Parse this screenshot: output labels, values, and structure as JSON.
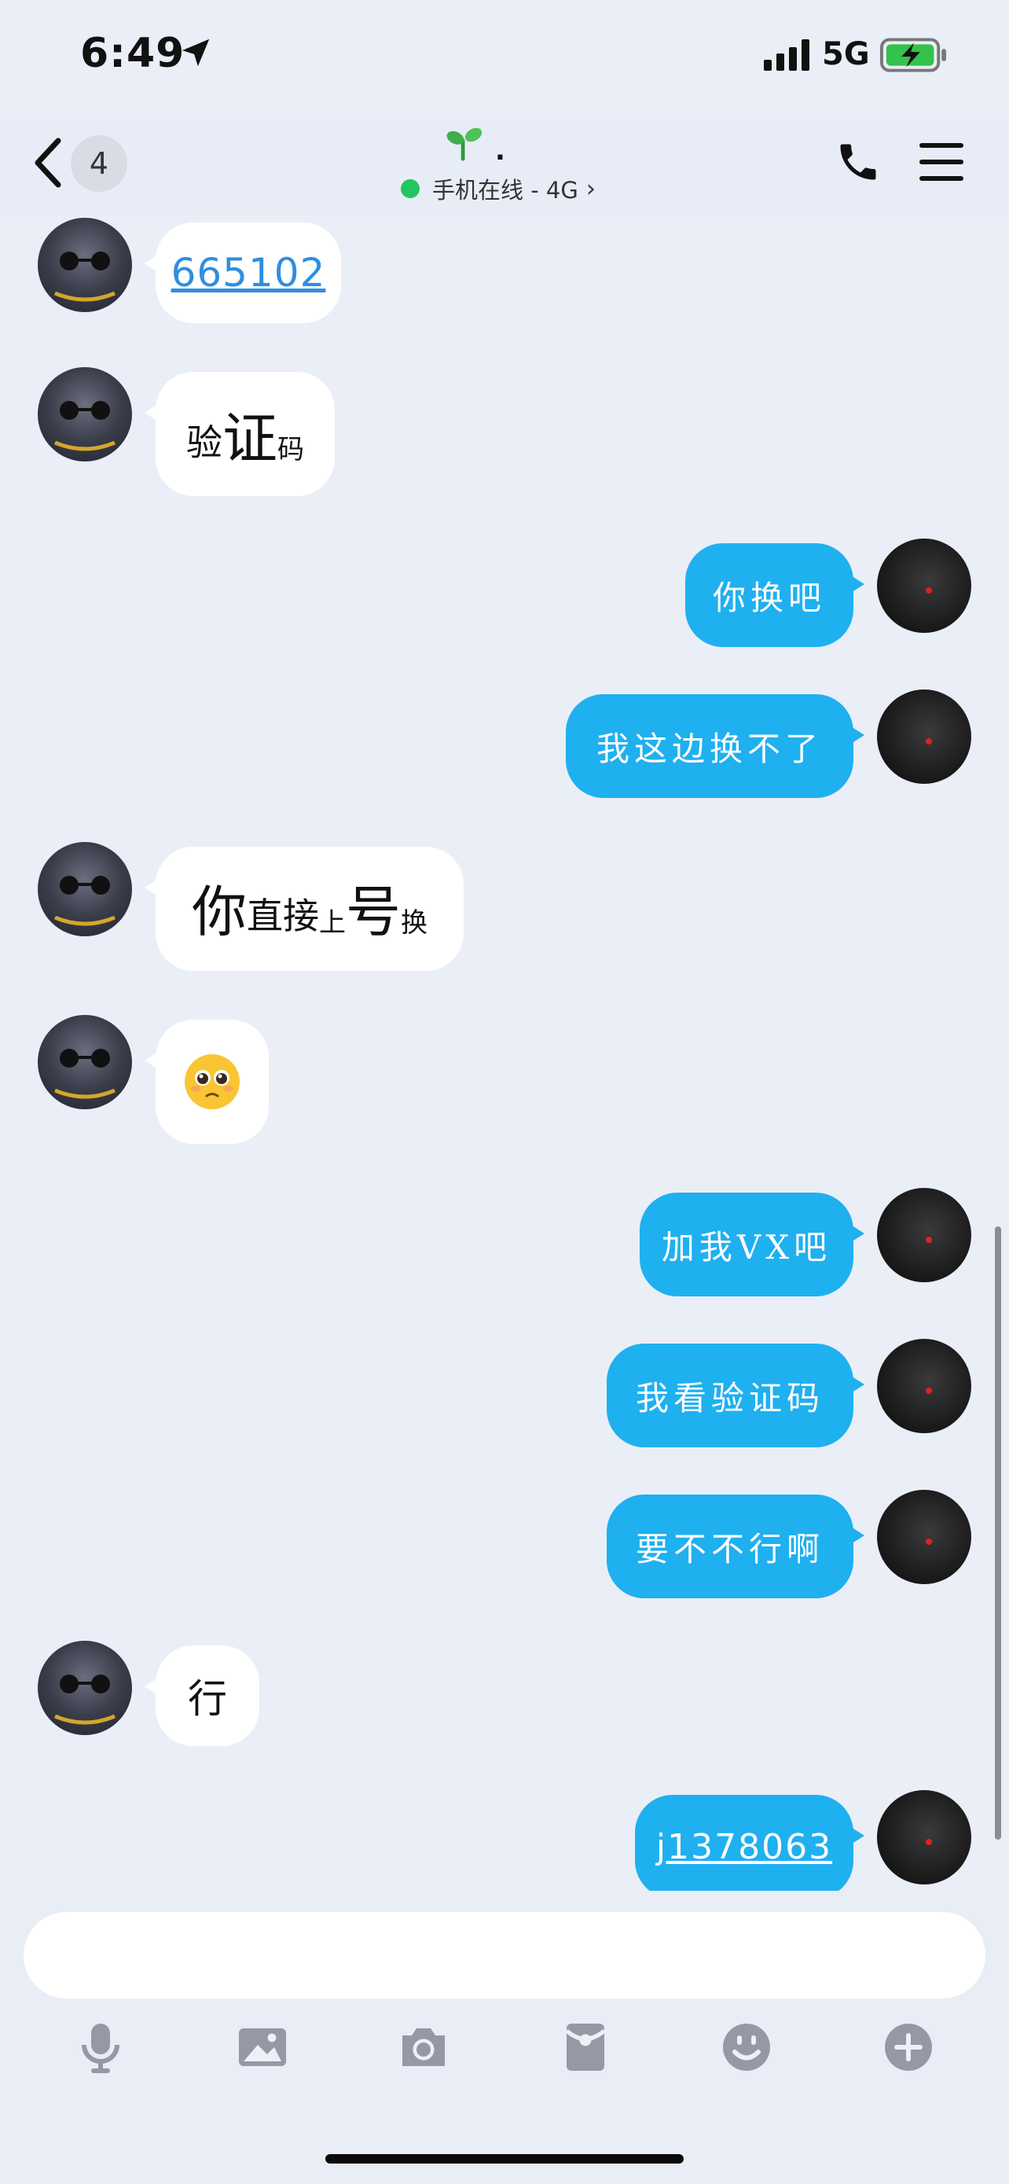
{
  "status_bar": {
    "time": "6:49",
    "network": "5G"
  },
  "nav": {
    "back_count": "4",
    "contact_name": ".",
    "presence_text": "手机在线 - 4G",
    "presence_chevron": "›"
  },
  "messages": [
    {
      "side": "theirs",
      "kind": "link",
      "text": "665102"
    },
    {
      "side": "theirs",
      "kind": "styled",
      "parts": [
        "验",
        "证",
        "码"
      ]
    },
    {
      "side": "mine",
      "kind": "text",
      "text": "你换吧"
    },
    {
      "side": "mine",
      "kind": "text",
      "text": "我这边换不了"
    },
    {
      "side": "theirs",
      "kind": "styled",
      "parts": [
        "你",
        "直接",
        "上",
        "号",
        "换"
      ]
    },
    {
      "side": "theirs",
      "kind": "emoji",
      "text": "🥺"
    },
    {
      "side": "mine",
      "kind": "text",
      "text": "加我VX吧"
    },
    {
      "side": "mine",
      "kind": "text",
      "text": "我看验证码"
    },
    {
      "side": "mine",
      "kind": "text",
      "text": "要不不行啊"
    },
    {
      "side": "theirs",
      "kind": "text",
      "text": "行"
    },
    {
      "side": "mine",
      "kind": "link",
      "text": "j1378063"
    }
  ],
  "input": {
    "placeholder": ""
  },
  "toolbar": [
    "microphone-icon",
    "image-icon",
    "camera-icon",
    "red-packet-icon",
    "emoji-icon",
    "plus-icon"
  ],
  "colors": {
    "my_bubble": "#1fb0f0",
    "their_bubble": "#ffffff",
    "background": "#eaeef7",
    "link": "#2f8ee0",
    "online": "#22c55e"
  }
}
